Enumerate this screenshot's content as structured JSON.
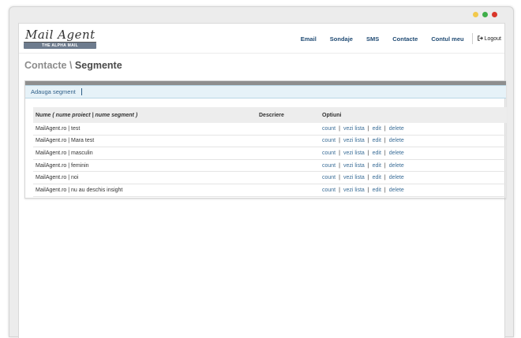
{
  "window": {
    "dots": [
      {
        "name": "window-minimize-dot",
        "color": "#f2c94c"
      },
      {
        "name": "window-maximize-dot",
        "color": "#3fae49"
      },
      {
        "name": "window-close-dot",
        "color": "#d9362b"
      }
    ]
  },
  "logo": {
    "script_text": "Mail Agent",
    "tagline": "THE ALPHA MAIL"
  },
  "nav": {
    "items": [
      "Email",
      "Sondaje",
      "SMS",
      "Contacte",
      "Contul meu"
    ],
    "logout_label": "Logout",
    "logout_icon": "logout-icon"
  },
  "page_title": {
    "part1": "Contacte",
    "separator": " \\ ",
    "part2": "Segmente"
  },
  "toolbar": {
    "add_segment_label": "Adauga segment"
  },
  "table": {
    "headers": {
      "name_bold": "Nume",
      "name_italic": "( nume proiect | nume segment )",
      "description": "Descriere",
      "options": "Optiuni"
    },
    "rows": [
      {
        "name": "MailAgent.ro | test"
      },
      {
        "name": "MailAgent.ro | Mara test"
      },
      {
        "name": "MailAgent.ro | masculin"
      },
      {
        "name": "MailAgent.ro | feminin"
      },
      {
        "name": "MailAgent.ro | noi"
      },
      {
        "name": "MailAgent.ro | nu au deschis insight"
      }
    ],
    "option_labels": {
      "count": "count",
      "view_list": "vezi lista",
      "edit": "edit",
      "delete": "delete",
      "separator": "|"
    }
  },
  "colors": {
    "link": "#3b6e98",
    "nav": "#1f4a73",
    "toolbar_bg": "#e6f2f8"
  }
}
